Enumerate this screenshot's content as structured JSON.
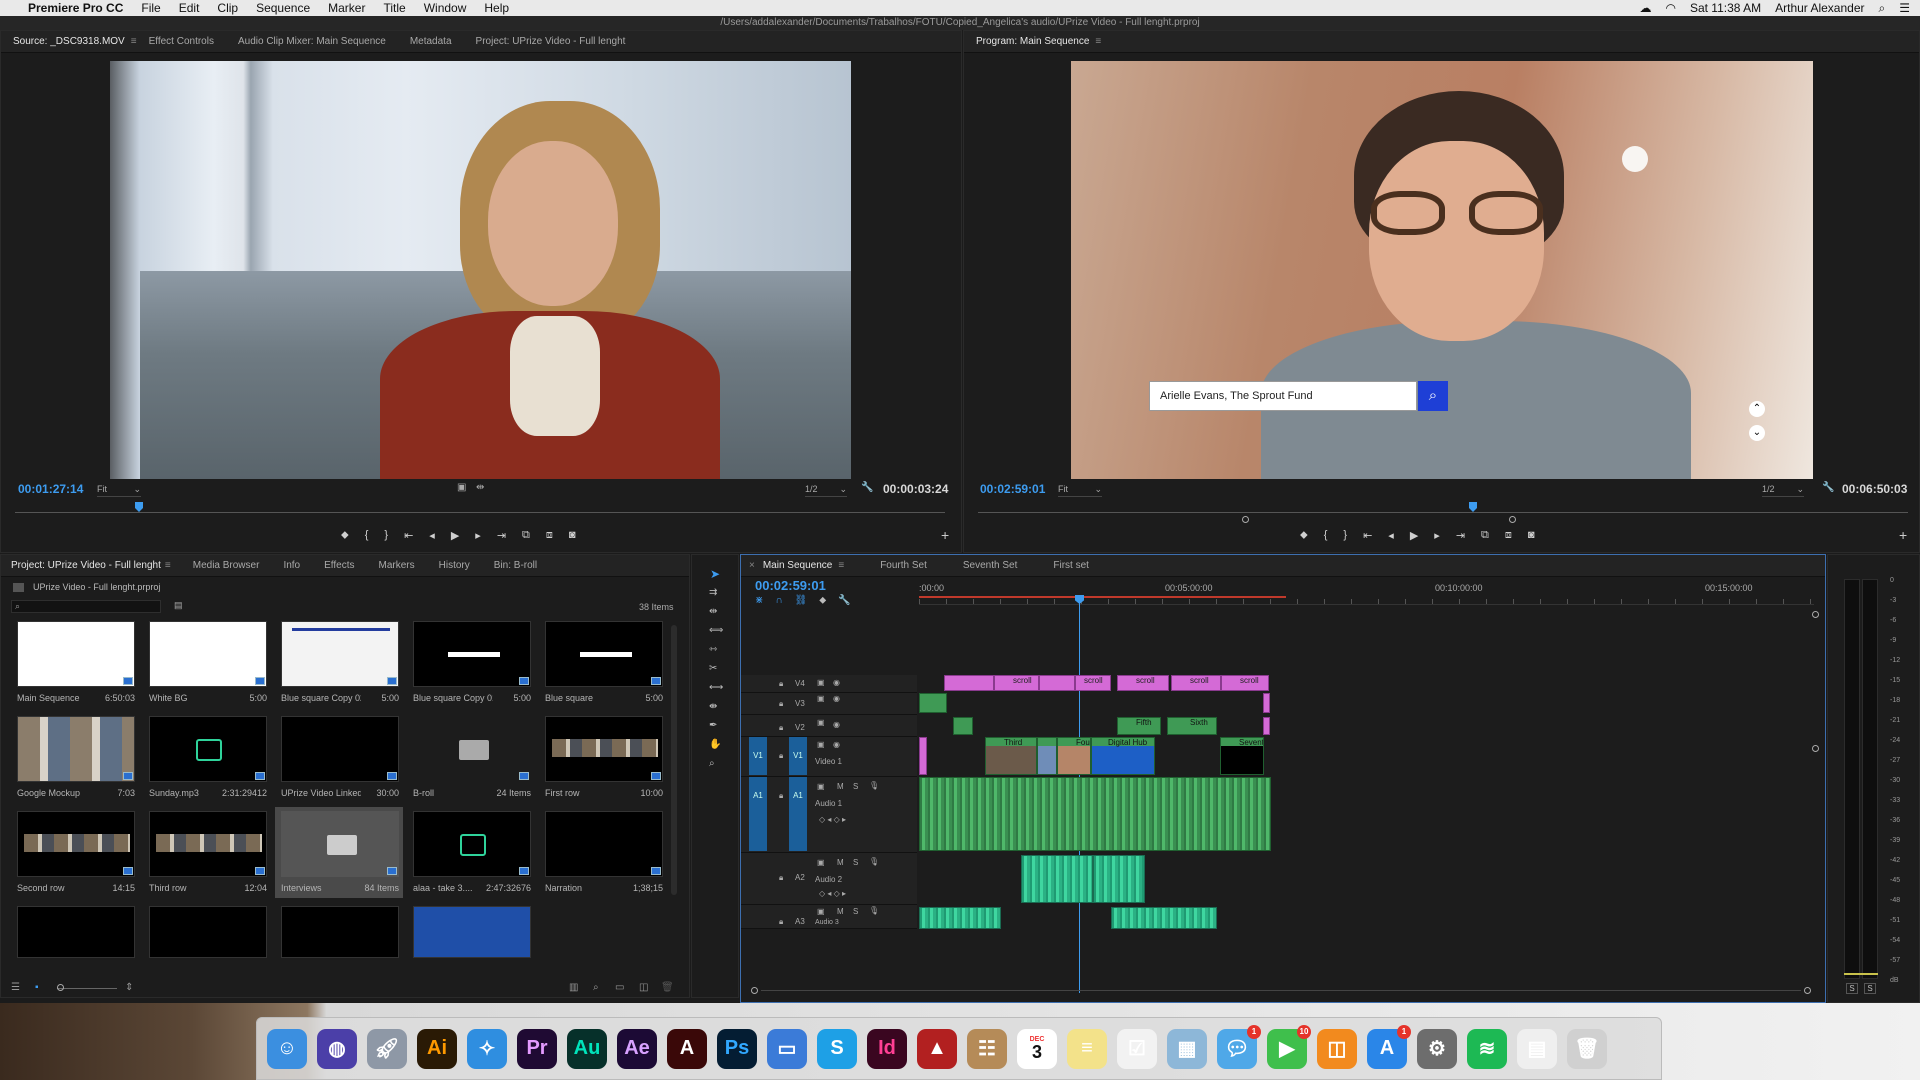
{
  "menubar": {
    "app": "Premiere Pro CC",
    "items": [
      "File",
      "Edit",
      "Clip",
      "Sequence",
      "Marker",
      "Title",
      "Window",
      "Help"
    ],
    "clock": "Sat 11:38 AM",
    "user": "Arthur Alexander"
  },
  "window_title": "/Users/addalexander/Documents/Trabalhos/FOTU/Copied_Angelica's audio/UPrize Video - Full lenght.prproj",
  "source_panel": {
    "tabs": [
      "Source: _DSC9318.MOV",
      "Effect Controls",
      "Audio Clip Mixer: Main Sequence",
      "Metadata",
      "Project: UPrize Video - Full lenght"
    ],
    "timecode": "00:01:27:14",
    "fit": "Fit",
    "resolution": "1/2",
    "duration": "00:00:03:24"
  },
  "program_panel": {
    "tab": "Program: Main Sequence",
    "timecode": "00:02:59:01",
    "fit": "Fit",
    "resolution": "1/2",
    "duration": "00:06:50:03",
    "search_value": "Arielle Evans, The Sprout Fund"
  },
  "project_panel": {
    "tabs": [
      "Project: UPrize Video - Full lenght",
      "Media Browser",
      "Info",
      "Effects",
      "Markers",
      "History",
      "Bin: B-roll"
    ],
    "project_file": "UPrize Video - Full lenght.prproj",
    "item_count": "38 Items",
    "items": [
      {
        "name": "Main Sequence",
        "meta": "6:50:03",
        "style": "white"
      },
      {
        "name": "White BG",
        "meta": "5:00",
        "style": "white"
      },
      {
        "name": "Blue square Copy 02",
        "meta": "5:00",
        "style": "web"
      },
      {
        "name": "Blue square Copy 01",
        "meta": "5:00",
        "style": "bar"
      },
      {
        "name": "Blue square",
        "meta": "5:00",
        "style": "bar"
      },
      {
        "name": "Google Mockup",
        "meta": "7:03",
        "style": "collage"
      },
      {
        "name": "Sunday.mp3",
        "meta": "2:31:29412",
        "style": "audio"
      },
      {
        "name": "UPrize Video Linked...",
        "meta": "30:00",
        "style": "black"
      },
      {
        "name": "B-roll",
        "meta": "24 Items",
        "style": "folder"
      },
      {
        "name": "First row",
        "meta": "10:00",
        "style": "strip"
      },
      {
        "name": "Second row",
        "meta": "14:15",
        "style": "strip"
      },
      {
        "name": "Third row",
        "meta": "12:04",
        "style": "strip"
      },
      {
        "name": "Interviews",
        "meta": "84 Items",
        "style": "folder-sel"
      },
      {
        "name": "alaa - take 3....",
        "meta": "2:47:32676",
        "style": "audio"
      },
      {
        "name": "Narration",
        "meta": "1;38;15",
        "style": "black"
      }
    ]
  },
  "timeline": {
    "tabs": [
      "Main Sequence",
      "Fourth Set",
      "Seventh Set",
      "First set"
    ],
    "timecode": "00:02:59:01",
    "ruler": [
      ":00:00",
      "00:05:00:00",
      "00:10:00:00",
      "00:15:00:00"
    ],
    "tracks": [
      {
        "id": "V4"
      },
      {
        "id": "V3"
      },
      {
        "id": "V2"
      },
      {
        "id": "V1",
        "name": "Video 1"
      },
      {
        "id": "A1",
        "name": "Audio 1"
      },
      {
        "id": "A2",
        "name": "Audio 2"
      },
      {
        "id": "A3",
        "name": "Audio 3"
      }
    ],
    "clip_labels": {
      "scroll": "scroll",
      "third": "Third",
      "fourth": "Four",
      "digital": "Digital Hub",
      "seventh": "Sevent",
      "fifth": "Fifth",
      "sixth": "Sixth"
    }
  },
  "meter": {
    "labels": [
      "0",
      "-3",
      "-6",
      "-9",
      "-12",
      "-15",
      "-18",
      "-21",
      "-24",
      "-27",
      "-30",
      "-33",
      "-36",
      "-39",
      "-42",
      "-45",
      "-48",
      "-51",
      "-54",
      "-57",
      "dB"
    ],
    "solo": "S"
  },
  "dock": [
    "Finder",
    "Siri",
    "Launchpad",
    "Ai",
    "Safari",
    "Pr",
    "Au",
    "Ae",
    "Acrobat",
    "Ps",
    "Keynote",
    "Skype",
    "Id",
    "SketchUp",
    "Contacts",
    "Calendar",
    "Notes",
    "Reminders",
    "Preview",
    "Messages",
    "FaceTime",
    "iBooks",
    "App Store",
    "System Preferences",
    "Spotify",
    "Document",
    "Trash"
  ],
  "dock_calendar": {
    "month": "DEC",
    "day": "3"
  },
  "dock_badges": {
    "messages": "1",
    "facetime": "10",
    "appstore": "1"
  }
}
